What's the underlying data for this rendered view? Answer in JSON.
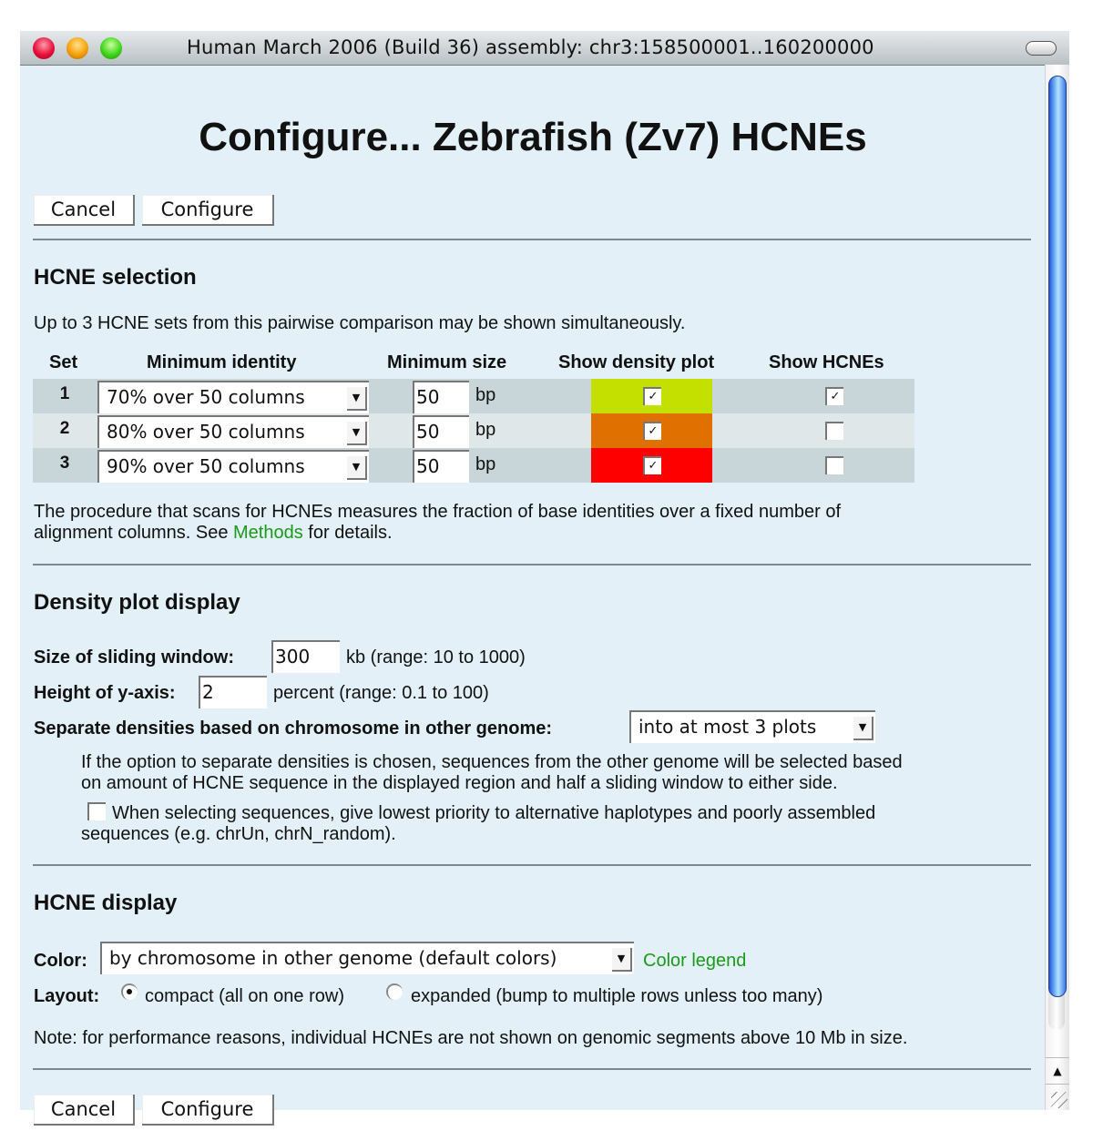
{
  "window": {
    "title": "Human March 2006 (Build 36) assembly: chr3:158500001..160200000"
  },
  "page": {
    "title": "Configure... Zebrafish (Zv7) HCNEs"
  },
  "buttons": {
    "cancel": "Cancel",
    "configure": "Configure"
  },
  "hcne_selection": {
    "title": "HCNE selection",
    "intro": "Up to 3 HCNE sets from this pairwise comparison may be shown simultaneously.",
    "headers": {
      "set": "Set",
      "min_identity": "Minimum identity",
      "min_size": "Minimum size",
      "show_density": "Show density plot",
      "show_hcnes": "Show HCNEs"
    },
    "rows": [
      {
        "set": "1",
        "identity": "70% over 50 columns",
        "size": "50",
        "unit": "bp",
        "color": "#c4e000",
        "density_checked": true,
        "hcnes_checked": true
      },
      {
        "set": "2",
        "identity": "80% over 50 columns",
        "size": "50",
        "unit": "bp",
        "color": "#e07000",
        "density_checked": true,
        "hcnes_checked": false
      },
      {
        "set": "3",
        "identity": "90% over 50 columns",
        "size": "50",
        "unit": "bp",
        "color": "#ff0000",
        "density_checked": true,
        "hcnes_checked": false
      }
    ],
    "note_line1": "The procedure that scans for HCNEs measures the fraction of base identities over a fixed number of",
    "note_line2_pre": "alignment columns. See ",
    "note_link": "Methods",
    "note_line2_post": " for details."
  },
  "density": {
    "title": "Density plot display",
    "window_label": "Size of sliding window:",
    "window_value": "300",
    "window_suffix": "kb (range: 10 to 1000)",
    "yaxis_label": "Height of y-axis:",
    "yaxis_value": "2",
    "yaxis_suffix": "percent (range: 0.1 to 100)",
    "separate_label": "Separate densities based on chromosome in other genome:",
    "separate_value": "into at most 3 plots",
    "separate_help_line1": "If the option to separate densities is chosen, sequences from the other genome will be selected based",
    "separate_help_line2": "on amount of HCNE sequence in the displayed region and half a sliding window to either side.",
    "priority_checked": false,
    "priority_line1": "When selecting sequences, give lowest priority to alternative haplotypes and poorly assembled",
    "priority_line2": "sequences (e.g. chrUn, chrN_random)."
  },
  "hcne_display": {
    "title": "HCNE display",
    "color_label": "Color:",
    "color_value": "by chromosome in other genome (default colors)",
    "color_legend_link": "Color legend",
    "layout_label": "Layout:",
    "layout_options": [
      {
        "label": "compact (all on one row)",
        "selected": true
      },
      {
        "label": "expanded (bump to multiple rows unless too many)",
        "selected": false
      }
    ],
    "note": "Note: for performance reasons, individual HCNEs are not shown on genomic segments above 10 Mb in size."
  }
}
